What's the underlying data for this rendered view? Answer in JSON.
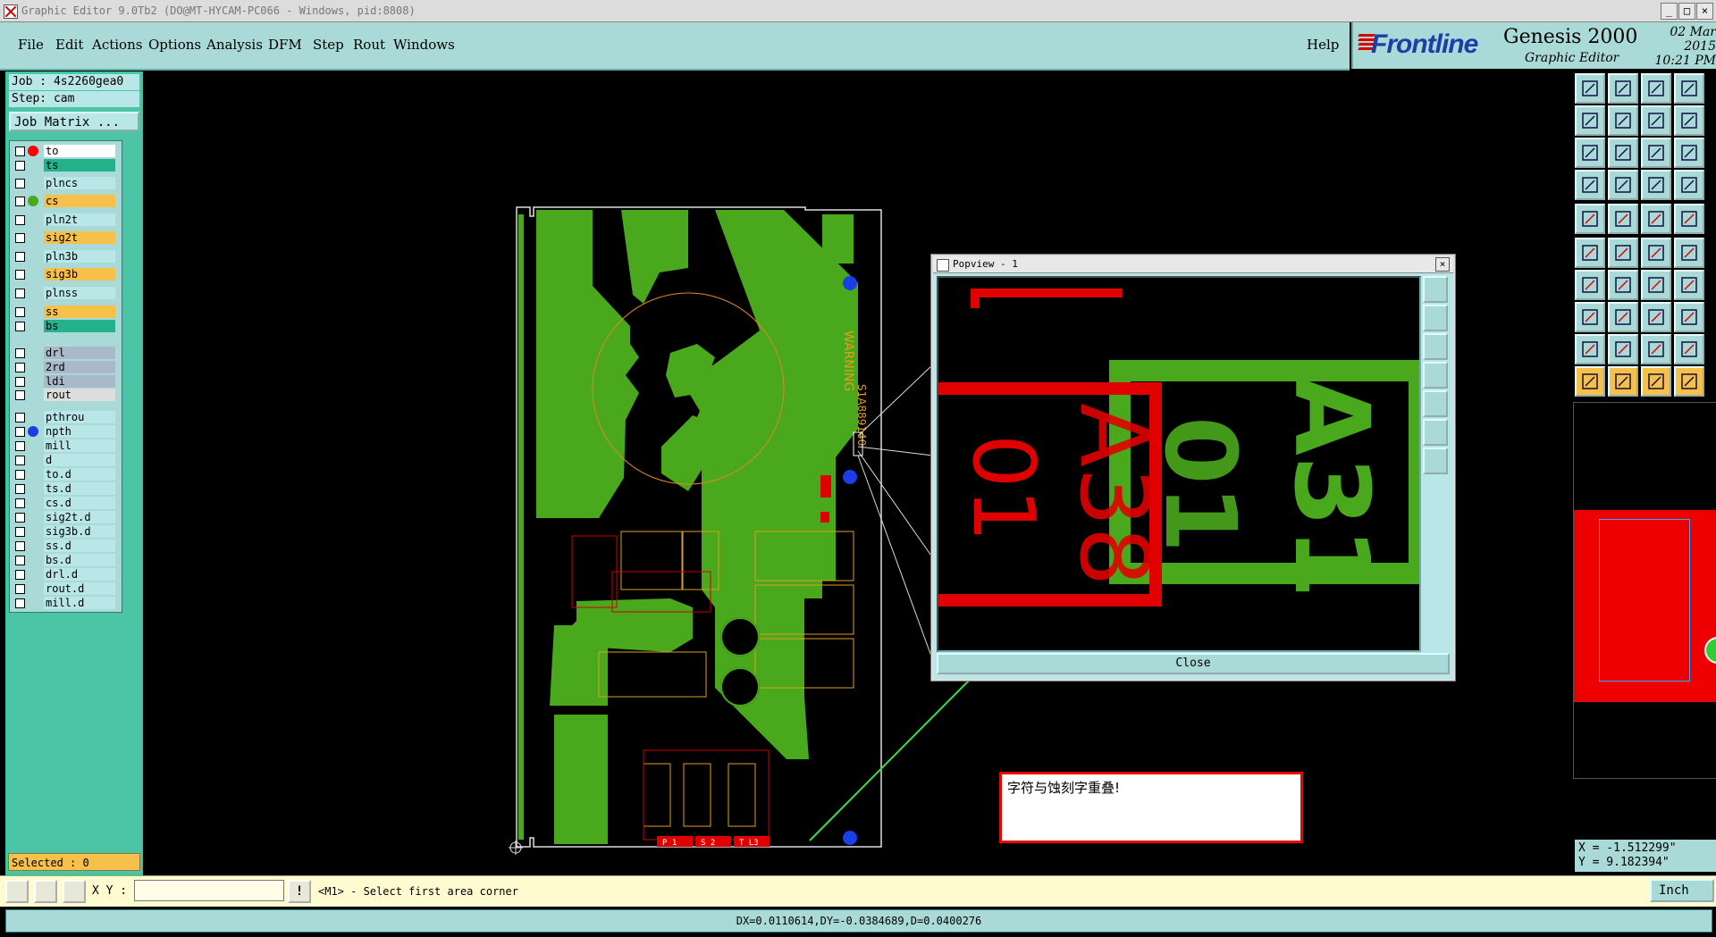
{
  "window": {
    "title": "Graphic Editor 9.0Tb2 (DO@MT-HYCAM-PC066 - Windows, pid:8808)"
  },
  "menu": {
    "items": [
      "File",
      "Edit",
      "Actions",
      "Options",
      "Analysis",
      "DFM",
      "Step",
      "Rout",
      "Windows"
    ],
    "help": "Help"
  },
  "brand": {
    "logo": "Frontline",
    "product": "Genesis 2000",
    "subtitle": "Graphic Editor",
    "date": "02 Mar 2015",
    "time": "10:21 PM"
  },
  "job": {
    "job_line": "Job : 4s2260gea0",
    "step_line": "Step: cam",
    "matrix_button": "Job Matrix ..."
  },
  "layers": [
    {
      "name": "to",
      "bg": "#ffffff",
      "dot": "#ff0000"
    },
    {
      "name": "ts",
      "bg": "#23b28b",
      "dot": ""
    },
    {
      "name": "plncs",
      "bg": "#b9e6e6",
      "dot": ""
    },
    {
      "name": "cs",
      "bg": "#f7c04a",
      "dot": "#4aa81c"
    },
    {
      "name": "pln2t",
      "bg": "#b9e6e6",
      "dot": ""
    },
    {
      "name": "sig2t",
      "bg": "#f7c04a",
      "dot": ""
    },
    {
      "name": "pln3b",
      "bg": "#b9e6e6",
      "dot": ""
    },
    {
      "name": "sig3b",
      "bg": "#f7c04a",
      "dot": ""
    },
    {
      "name": "plnss",
      "bg": "#b9e6e6",
      "dot": ""
    },
    {
      "name": "ss",
      "bg": "#f7c04a",
      "dot": ""
    },
    {
      "name": "bs",
      "bg": "#23b28b",
      "dot": ""
    },
    {
      "name": "drl",
      "bg": "#a9b9c9",
      "dot": ""
    },
    {
      "name": "2rd",
      "bg": "#a9b9c9",
      "dot": ""
    },
    {
      "name": "ldi",
      "bg": "#a9b9c9",
      "dot": ""
    },
    {
      "name": "rout",
      "bg": "#dddddd",
      "dot": ""
    },
    {
      "name": "pthrou",
      "bg": "#b9e6e6",
      "dot": ""
    },
    {
      "name": "npth",
      "bg": "#b9e6e6",
      "dot": "#1a3ee8"
    },
    {
      "name": "mill",
      "bg": "#b9e6e6",
      "dot": ""
    },
    {
      "name": "d",
      "bg": "#b9e6e6",
      "dot": ""
    },
    {
      "name": "to.d",
      "bg": "#b9e6e6",
      "dot": ""
    },
    {
      "name": "ts.d",
      "bg": "#b9e6e6",
      "dot": ""
    },
    {
      "name": "cs.d",
      "bg": "#b9e6e6",
      "dot": ""
    },
    {
      "name": "sig2t.d",
      "bg": "#b9e6e6",
      "dot": ""
    },
    {
      "name": "sig3b.d",
      "bg": "#b9e6e6",
      "dot": ""
    },
    {
      "name": "ss.d",
      "bg": "#b9e6e6",
      "dot": ""
    },
    {
      "name": "bs.d",
      "bg": "#b9e6e6",
      "dot": ""
    },
    {
      "name": "drl.d",
      "bg": "#b9e6e6",
      "dot": ""
    },
    {
      "name": "rout.d",
      "bg": "#b9e6e6",
      "dot": ""
    },
    {
      "name": "mill.d",
      "bg": "#b9e6e6",
      "dot": ""
    }
  ],
  "selected": "Selected : 0",
  "popview": {
    "title": "Popview - 1",
    "close": "Close",
    "texts": [
      "A31",
      "01",
      "A38",
      "01"
    ]
  },
  "board_labels": {
    "warning": "WARNING",
    "part_no": "S1A889140",
    "terminals": [
      "P  1",
      "S  2",
      "T  L3"
    ]
  },
  "message": "字符与蚀刻字重叠!",
  "coords": {
    "x": "X = -1.512299\"",
    "y": "Y = 9.182394\""
  },
  "command": {
    "xy_label": "X Y :",
    "xy_value": "",
    "prompt": "<M1> - Select first area corner",
    "units": "Inch"
  },
  "status": "DX=0.0110614,DY=-0.0384689,D=0.0400276",
  "colors": {
    "panel": "#a9dad7",
    "panel_dark": "#4cc5a6",
    "board": "#4aa81c",
    "silk": "#e00000",
    "accent": "#f7c04a"
  }
}
